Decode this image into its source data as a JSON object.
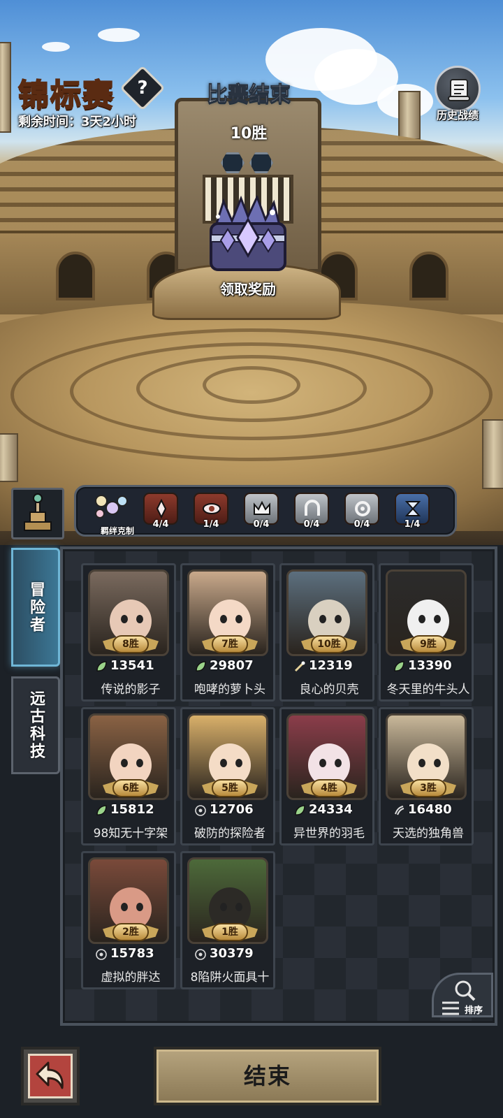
{
  "header": {
    "title": "锦标赛",
    "help_symbol": "?",
    "remaining_time": "剩余时间：3天2小时",
    "history_label": "历史战绩"
  },
  "result": {
    "status": "比赛结束",
    "wins": "10胜",
    "claim_label": "领取奖励"
  },
  "bonds": {
    "label": "羁绊克制",
    "slots": [
      {
        "icon": "diamond-spark-icon",
        "count": "4/4",
        "state": "active"
      },
      {
        "icon": "eye-icon",
        "count": "1/4",
        "state": "active"
      },
      {
        "icon": "crown-icon",
        "count": "0/4",
        "state": "inactive"
      },
      {
        "icon": "arch-icon",
        "count": "0/4",
        "state": "inactive"
      },
      {
        "icon": "ring-icon",
        "count": "0/4",
        "state": "inactive"
      },
      {
        "icon": "hourglass-icon",
        "count": "1/4",
        "state": "active-blue"
      }
    ]
  },
  "tabs": {
    "adventurer": "冒险者",
    "tech": "远古科技"
  },
  "heroes": [
    {
      "name": "传说的影子",
      "wins": "8胜",
      "power": "13541",
      "type": "leaf-icon"
    },
    {
      "name": "咆哮的萝卜头",
      "wins": "7胜",
      "power": "29807",
      "type": "leaf-icon"
    },
    {
      "name": "良心的贝壳",
      "wins": "10胜",
      "power": "12319",
      "type": "wand-icon"
    },
    {
      "name": "冬天里的牛头人",
      "wins": "9胜",
      "power": "13390",
      "type": "leaf-icon"
    },
    {
      "name": "98知无十字架",
      "wins": "6胜",
      "power": "15812",
      "type": "leaf-icon"
    },
    {
      "name": "破防的探险者",
      "wins": "5胜",
      "power": "12706",
      "type": "target-icon"
    },
    {
      "name": "异世界的羽毛",
      "wins": "4胜",
      "power": "24334",
      "type": "leaf-icon"
    },
    {
      "name": "天选的独角兽",
      "wins": "3胜",
      "power": "16480",
      "type": "claw-icon"
    },
    {
      "name": "虚拟的胖达",
      "wins": "2胜",
      "power": "15783",
      "type": "target-icon"
    },
    {
      "name": "8陷阱火面具十",
      "wins": "1胜",
      "power": "30379",
      "type": "target-icon"
    }
  ],
  "sort_label": "排序",
  "finish_label": "结束",
  "colors": {
    "accent_gold": "#f8dfa1",
    "tab_active": "#6fb6d6",
    "back_red": "#b3443e"
  }
}
